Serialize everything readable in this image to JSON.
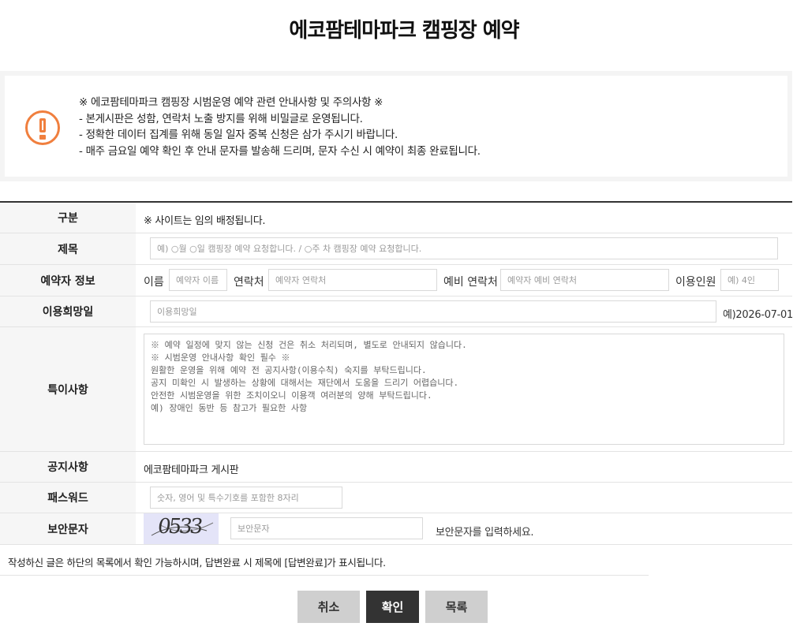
{
  "page_title": "에코팜테마파크 캠핑장 예약",
  "notice": {
    "icon": "exclamation-circle-icon",
    "accent_color": "#f07f3e",
    "lines": [
      "※ 에코팜테마파크 캠핑장 시범운영 예약 관련 안내사항 및 주의사항 ※",
      "- 본게시판은 성함, 연락처 노출 방지를 위해 비밀글로 운영됩니다.",
      "- 정확한 데이터 집계를 위해 동일 일자 중복 신청은 삼가 주시기 바랍니다.",
      "- 매주 금요일 예약 확인 후 안내 문자를 발송해 드리며, 문자 수신 시 예약이 최종 완료됩니다."
    ]
  },
  "form": {
    "category": {
      "label": "구분",
      "value": "※ 사이트는 임의 배정됩니다."
    },
    "subject": {
      "label": "제목",
      "placeholder": "예) ○월 ○일 캠핑장 예약 요청합니다. / ○주 차 캠핑장 예약 요청합니다."
    },
    "reserver": {
      "label": "예약자 정보",
      "name_label": "이름",
      "name_placeholder": "예약자 이름",
      "contact_label": "연락처",
      "contact_placeholder": "예약자 연락처",
      "backup_label": "예비 연락처",
      "backup_placeholder": "예약자 예비 연락처",
      "people_label": "이용인원",
      "people_placeholder": "예) 4인"
    },
    "date": {
      "label": "이용희망일",
      "placeholder": "이용희망일",
      "example": "예)2026-07-01"
    },
    "remarks": {
      "label": "특이사항",
      "text": "※ 예약 일정에 맞지 않는 신청 건은 취소 처리되며, 별도로 안내되지 않습니다.\n※ 시범운영 안내사항 확인 필수 ※\n원활한 운영을 위해 예약 전 공지사항(이용수칙) 숙지를 부탁드립니다.\n공지 미확인 시 발생하는 상황에 대해서는 재단에서 도움을 드리기 어렵습니다.\n안전한 시범운영을 위한 조치이오니 이용객 여러분의 양해 부탁드립니다.\n예) 장애인 동반 등 참고가 필요한 사항"
    },
    "board": {
      "label": "공지사항",
      "value": "에코팜테마파크 게시판"
    },
    "password": {
      "label": "패스워드",
      "placeholder": "숫자, 영어 및 특수기호를 포함한 8자리"
    },
    "captcha": {
      "label": "보안문자",
      "image_text": "0533",
      "placeholder": "보안문자",
      "hint": "보안문자를 입력하세요."
    }
  },
  "footer_note": "작성하신 글은 하단의 목록에서 확인 가능하시며, 답변완료 시 제목에 [답변완료]가 표시됩니다.",
  "buttons": {
    "cancel": "취소",
    "confirm": "확인",
    "list": "목록"
  }
}
